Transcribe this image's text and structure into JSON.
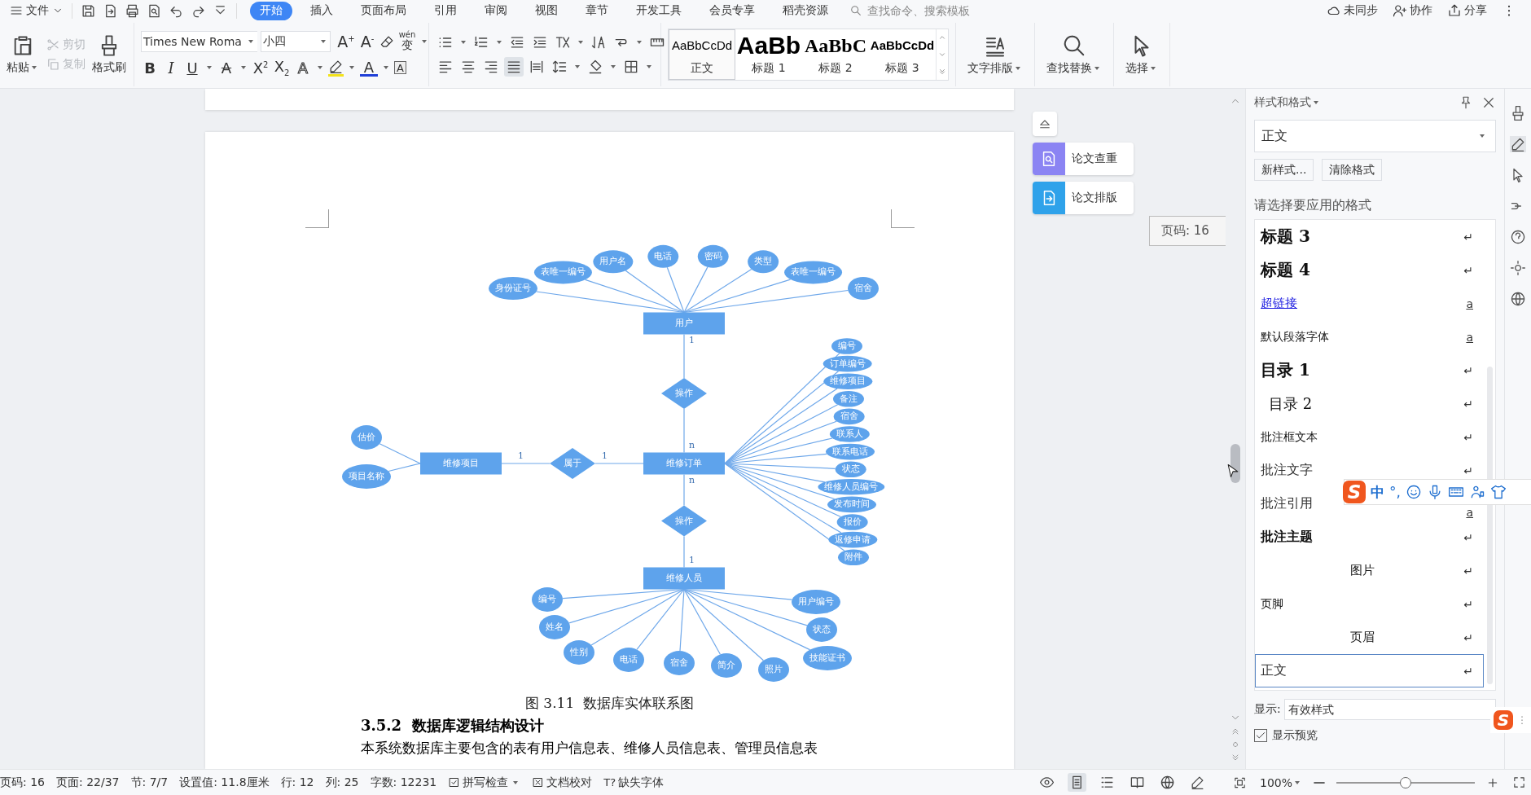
{
  "menu_bar": {
    "file_menu": "文件",
    "tabs": [
      {
        "label": "开始",
        "selected": true
      },
      {
        "label": "插入",
        "selected": false
      },
      {
        "label": "页面布局",
        "selected": false
      },
      {
        "label": "引用",
        "selected": false
      },
      {
        "label": "审阅",
        "selected": false
      },
      {
        "label": "视图",
        "selected": false
      },
      {
        "label": "章节",
        "selected": false
      },
      {
        "label": "开发工具",
        "selected": false
      },
      {
        "label": "会员专享",
        "selected": false
      },
      {
        "label": "稻壳资源",
        "selected": false
      }
    ],
    "search": {
      "placeholder": "查找命令、搜索模板"
    },
    "actions": [
      {
        "label": "未同步",
        "kind": "sync"
      },
      {
        "label": "协作",
        "kind": "collab"
      },
      {
        "label": "分享",
        "kind": "share"
      }
    ]
  },
  "ribbon": {
    "clipboard": {
      "paste": "粘贴",
      "cut": {
        "label": "剪切",
        "disabled": true
      },
      "copy": {
        "label": "复制",
        "disabled": true
      },
      "format_painter": "格式刷"
    },
    "font": {
      "name": "Times New Roma",
      "size": "小四",
      "size_buttons": [
        "A$^{+}$",
        "A$^{-}$"
      ],
      "phonetic": {
        "top": "wén",
        "bottom": "变"
      },
      "format_buttons": [
        {
          "label": "B",
          "kind": "bold"
        },
        {
          "label": "I",
          "kind": "italic"
        },
        {
          "label": "U",
          "kind": "underline"
        },
        {
          "label": "A",
          "kind": "strike"
        },
        {
          "label": "X$^{2}$",
          "kind": "plain"
        },
        {
          "label": "X$_{2}$",
          "kind": "plain"
        },
        {
          "label": "A",
          "kind": "outline"
        },
        {
          "kind": "highlight"
        },
        {
          "label": "A",
          "kind": "color"
        },
        {
          "label": "A",
          "kind": "boxed"
        }
      ]
    },
    "align_buttons": [
      {
        "kind": "left",
        "selected": false
      },
      {
        "kind": "center",
        "selected": false
      },
      {
        "kind": "right",
        "selected": false
      },
      {
        "kind": "justify",
        "selected": true
      },
      {
        "kind": "distributed",
        "selected": false
      }
    ],
    "styles": [
      {
        "preview": "AaBbCcDd",
        "name": "正文",
        "kind": "body",
        "selected": true
      },
      {
        "preview": "AaBb",
        "name": "标题 1",
        "kind": "h1",
        "selected": false
      },
      {
        "preview": "AaBbC",
        "name": "标题 2",
        "kind": "h2",
        "selected": false
      },
      {
        "preview": "AaBbCcDd",
        "name": "标题 3",
        "kind": "h3",
        "selected": false
      }
    ],
    "big_buttons": [
      {
        "label": "文字排版",
        "kind": "layout"
      },
      {
        "label": "查找替换",
        "kind": "find"
      },
      {
        "label": "选择",
        "kind": "select"
      }
    ]
  },
  "document": {
    "er_diagram": {
      "entities": [
        {
          "name": "用户",
          "attributes": [
            "身份证号",
            "表唯一编号",
            "用户名",
            "电话",
            "密码",
            "类型",
            "表唯一编号",
            "宿舍"
          ]
        },
        {
          "name": "维修订单",
          "attributes": [
            "编号",
            "订单编号",
            "维修项目",
            "备注",
            "宿舍",
            "联系人",
            "联系电话",
            "状态",
            "维修人员编号",
            "发布时间",
            "报价",
            "返修申请",
            "附件"
          ]
        },
        {
          "name": "维修项目",
          "attributes": [
            "估价",
            "项目名称"
          ]
        },
        {
          "name": "维修人员",
          "attributes": [
            "编号",
            "姓名",
            "性别",
            "电话",
            "宿舍",
            "简介",
            "照片",
            "用户编号",
            "状态",
            "技能证书"
          ]
        }
      ],
      "relationships": [
        {
          "name": "操作",
          "from_card": "1",
          "to_card": "n"
        },
        {
          "name": "属于",
          "from_card": "1",
          "to_card": "1"
        },
        {
          "name": "操作",
          "from_card": "n",
          "to_card": "1"
        }
      ]
    },
    "caption": "图 3.11  数据库实体联系图",
    "heading": "3.5.2  数据库逻辑结构设计",
    "body": "本系统数据库主要包含的表有用户信息表、维修人员信息表、管理员信息表"
  },
  "side_tools": {
    "buttons": [
      {
        "label": "论文查重",
        "kind": "check"
      },
      {
        "label": "论文排版",
        "kind": "format"
      }
    ],
    "page_tip": "页码: 16"
  },
  "styles_panel": {
    "title": "样式和格式",
    "current": "正文",
    "buttons": [
      "新样式...",
      "清除格式"
    ],
    "prompt": "请选择要应用的格式",
    "items": [
      {
        "label": "标题 3",
        "kind": "h3",
        "mark": "↵",
        "selected": false
      },
      {
        "label": "标题 4",
        "kind": "h4",
        "mark": "↵",
        "selected": false
      },
      {
        "label": "超链接",
        "kind": "link",
        "mark": "a",
        "selected": false
      },
      {
        "label": "默认段落字体",
        "kind": "plain",
        "mark": "a",
        "selected": false
      },
      {
        "label": "目录 1",
        "kind": "toc1",
        "mark": "↵",
        "selected": false
      },
      {
        "label": "目录 2",
        "kind": "toc2",
        "mark": "↵",
        "selected": false
      },
      {
        "label": "批注框文本",
        "kind": "small",
        "mark": "↵",
        "selected": false
      },
      {
        "label": "批注文字",
        "kind": "serif",
        "mark": "↵",
        "selected": false
      },
      {
        "label": "批注引用",
        "kind": "serif",
        "mark": "a",
        "selected": false
      },
      {
        "label": "批注主题",
        "kind": "bold",
        "mark": "↵",
        "selected": false
      },
      {
        "label": "图片",
        "kind": "center",
        "mark": "↵",
        "selected": false
      },
      {
        "label": "页脚",
        "kind": "small",
        "mark": "↵",
        "selected": false
      },
      {
        "label": "页眉",
        "kind": "center",
        "mark": "↵",
        "selected": false
      },
      {
        "label": "正文",
        "kind": "serif",
        "mark": "↵",
        "selected": true
      }
    ],
    "show_label": "显示:",
    "show_value": "有效样式",
    "preview": {
      "label": "显示预览",
      "checked": true
    }
  },
  "ime_toolbar": {
    "logo": "S",
    "items": [
      "中",
      "°,"
    ],
    "mini_logo": "S"
  },
  "status_bar": {
    "items": [
      "页码: 16",
      "页面: 22/37",
      "节: 7/7",
      "设置值: 11.8厘米",
      "行: 12",
      "列: 25",
      "字数: 12231"
    ],
    "tools": [
      {
        "label": "拼写检查",
        "kind": "spell"
      },
      {
        "label": "文档校对",
        "kind": "proof"
      },
      {
        "label": "缺失字体",
        "kind": "font",
        "icon_text": "T?"
      }
    ],
    "zoom": {
      "value": "100%",
      "level": 0.5
    }
  }
}
